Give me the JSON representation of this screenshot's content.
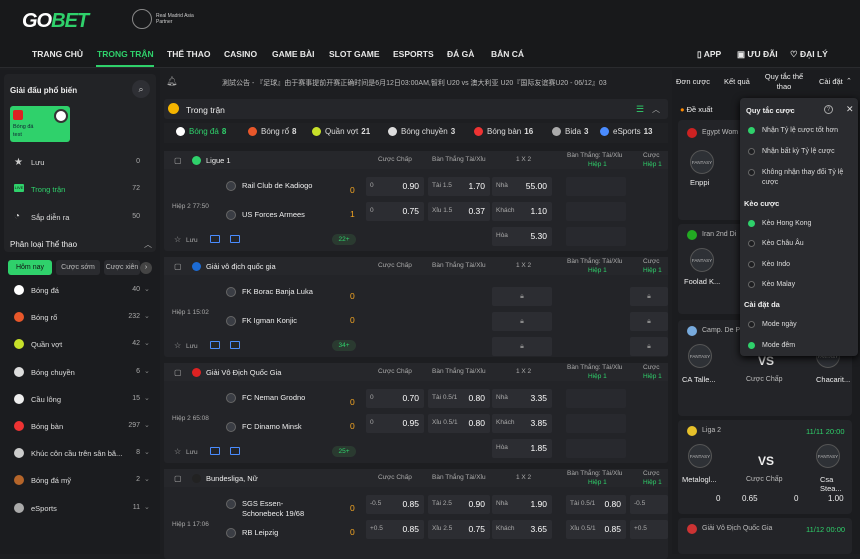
{
  "brand": {
    "logo_main": "GO",
    "logo_accent": "BET",
    "partner": "Real Madrid Asia Partner"
  },
  "nav": {
    "items": [
      "TRANG CHỦ",
      "TRONG TRẬN",
      "THỂ THAO",
      "CASINO",
      "GAME BÀI",
      "SLOT GAME",
      "ESPORTS",
      "ĐÁ GÀ",
      "BẮN CÁ"
    ],
    "right": [
      "APP",
      "ƯU ĐÃI",
      "ĐẠI LÝ"
    ]
  },
  "left": {
    "popular_title": "Giải đấu phổ biến",
    "promo_caption": "Bóng đá",
    "promo_sub": "test",
    "quick": [
      {
        "label": "Lưu",
        "count": "0"
      },
      {
        "label": "Trong trận",
        "count": "72"
      },
      {
        "label": "Sắp diễn ra",
        "count": "50"
      }
    ],
    "sport_title": "Phân loại Thể thao",
    "tabs": [
      "Hôm nay",
      "Cược sớm",
      "Cược xiên"
    ],
    "sports": [
      {
        "label": "Bóng đá",
        "count": "40"
      },
      {
        "label": "Bóng rổ",
        "count": "232"
      },
      {
        "label": "Quần vợt",
        "count": "42"
      },
      {
        "label": "Bóng chuyền",
        "count": "6"
      },
      {
        "label": "Cầu lông",
        "count": "15"
      },
      {
        "label": "Bóng bàn",
        "count": "297"
      },
      {
        "label": "Khúc côn cầu trên sân bă...",
        "count": "8"
      },
      {
        "label": "Bóng đá mỹ",
        "count": "2"
      },
      {
        "label": "eSports",
        "count": "11"
      }
    ]
  },
  "ticker": "測試公告 - 『足球』由于赛事提前开赛正确时间是6月12日03:00AM,智利 U20 vs 澳大利亚 U20『国际友谊赛U20 - 06/12』03",
  "top_right": [
    "Đơn cược",
    "Kết quả",
    "Quy tắc thể thao",
    "Cài đặt"
  ],
  "center": {
    "title": "Trong trận",
    "sport_tabs": [
      {
        "label": "Bóng đá",
        "count": "8"
      },
      {
        "label": "Bóng rổ",
        "count": "8"
      },
      {
        "label": "Quần vợt",
        "count": "21"
      },
      {
        "label": "Bóng chuyền",
        "count": "3"
      },
      {
        "label": "Bóng bàn",
        "count": "16"
      },
      {
        "label": "Bida",
        "count": "3"
      },
      {
        "label": "eSports",
        "count": "13"
      }
    ],
    "col_heads": {
      "hcp": "Cược Chấp",
      "ou": "Bàn Thắng Tài/Xỉu",
      "x12": "1 X 2",
      "ou_h1": "Bàn Thắng: Tài/Xỉu",
      "half": "Hiệp 1",
      "hcp_h1": "Cược"
    },
    "matches": [
      {
        "league": "Ligue 1",
        "time": "Hiệp 2 77:50",
        "home": "Rail Club de Kadiogo",
        "away": "US Forces Armees",
        "hs": "0",
        "as": "1",
        "more": "22+",
        "hcp": [
          [
            "0",
            "0.90"
          ],
          [
            "0",
            "0.75"
          ]
        ],
        "ou": [
          [
            "Tài 1.5",
            "1.70"
          ],
          [
            "Xỉu 1.5",
            "0.37"
          ]
        ],
        "x12": [
          [
            "Nhà",
            "55.00"
          ],
          [
            "Khách",
            "1.10"
          ],
          [
            "Hòa",
            "5.30"
          ]
        ],
        "save": "Lưu"
      },
      {
        "league": "Giải vô địch quốc gia",
        "time": "Hiệp 1 15:02",
        "home": "FK Borac Banja Luka",
        "away": "FK Igman Konjic",
        "hs": "0",
        "as": "0",
        "more": "34+",
        "save": "Lưu"
      },
      {
        "league": "Giải Vô Địch Quốc Gia",
        "time": "Hiệp 2 65:08",
        "home": "FC Neman Grodno",
        "away": "FC Dinamo Minsk",
        "hs": "0",
        "as": "0",
        "more": "25+",
        "hcp": [
          [
            "0",
            "0.70"
          ],
          [
            "0",
            "0.95"
          ]
        ],
        "ou": [
          [
            "Tài 0.5/1",
            "0.80"
          ],
          [
            "Xỉu 0.5/1",
            "0.80"
          ]
        ],
        "x12": [
          [
            "Nhà",
            "3.35"
          ],
          [
            "Khách",
            "3.85"
          ],
          [
            "Hòa",
            "1.85"
          ]
        ],
        "save": "Lưu"
      },
      {
        "league": "Bundesliga, Nữ",
        "time": "Hiệp 1 17:06",
        "home": "SGS Essen-Schonebeck 19/68",
        "away": "RB Leipzig",
        "hs": "0",
        "as": "0",
        "hcp": [
          [
            "-0.5",
            "0.85"
          ],
          [
            "+0.5",
            "0.85"
          ]
        ],
        "ou": [
          [
            "Tài 2.5",
            "0.90"
          ],
          [
            "Xỉu 2.5",
            "0.75"
          ]
        ],
        "x12": [
          [
            "Nhà",
            "1.90"
          ],
          [
            "Khách",
            "3.65"
          ]
        ],
        "ou_h1": [
          [
            "Tài 0.5/1",
            "0.80"
          ],
          [
            "Xỉu 0.5/1",
            "0.85"
          ]
        ],
        "hcp_h1": [
          [
            "-0.5",
            ""
          ],
          [
            "+0.5",
            ""
          ]
        ]
      }
    ]
  },
  "right": {
    "proposed": "Đề xuất",
    "cards": [
      {
        "league": "Egypt Wom",
        "team": "Enppi"
      },
      {
        "league": "Iran 2nd Di",
        "team": "Foolad K..."
      },
      {
        "league": "Camp. De P",
        "home": "CA Talle...",
        "away": "Chacarit...",
        "vs": "VS",
        "bet": "Cược Chấp"
      },
      {
        "league": "Liga 2",
        "date": "11/11 20:00",
        "home": "Metalogl...",
        "away": "Csa Stea...",
        "vs": "VS",
        "bet": "Cược Chấp",
        "v1": "0",
        "v2": "0.65",
        "v3": "0",
        "v4": "1.00"
      },
      {
        "league": "Giải Vô Địch Quốc Gia",
        "date": "11/12 00:00"
      }
    ]
  },
  "popup": {
    "title": "Quy tắc cược",
    "odds_options": [
      "Nhận Tỷ lệ cược tốt hơn",
      "Nhận bất kỳ Tỷ lệ cược",
      "Không nhận thay đổi Tỷ lệ cược"
    ],
    "kèo_title": "Kèo cược",
    "keo_options": [
      "Kèo Hong Kong",
      "Kèo Châu Âu",
      "Kèo Indo",
      "Kèo Malay"
    ],
    "settings_title": "Cài đặt da",
    "mode_options": [
      "Mode ngày",
      "Mode đêm"
    ]
  },
  "colors": {
    "accent": "#2fd16b",
    "bg": "#1d1e21"
  }
}
